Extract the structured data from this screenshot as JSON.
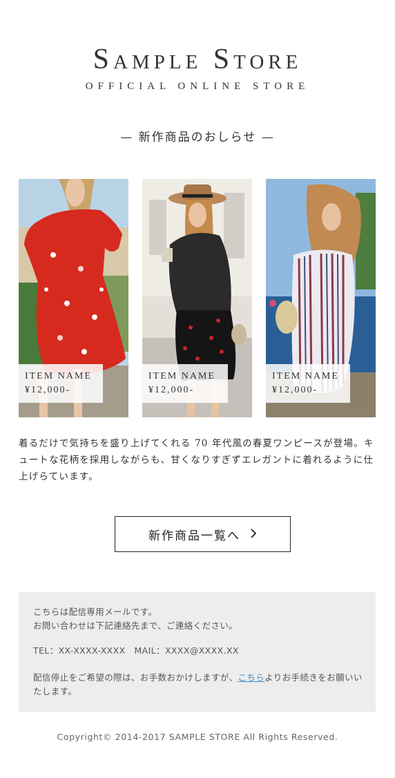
{
  "header": {
    "logo": "Sample Store",
    "tagline": "OFFICIAL ONLINE STORE"
  },
  "section": {
    "title": "— 新作商品のおしらせ —"
  },
  "products": [
    {
      "name": "ITEM NAME",
      "price": "¥12,000-",
      "image": "red-floral-dress-photo"
    },
    {
      "name": "ITEM NAME",
      "price": "¥12,000-",
      "image": "leather-jacket-cherry-skirt-photo"
    },
    {
      "name": "ITEM NAME",
      "price": "¥12,000-",
      "image": "striped-offshoulder-dress-photo"
    }
  ],
  "description": "着るだけで気持ちを盛り上げてくれる 70 年代風の春夏ワンピースが登場。キュートな花柄を採用しながらも、甘くなりすぎずエレガントに着れるように仕上げらています。",
  "cta": {
    "label": "新作商品一覧へ",
    "icon": "chevron-right-icon"
  },
  "info": {
    "notice_line1": "こちらは配信専用メールです。",
    "notice_line2": "お問い合わせは下記連絡先まで、ご連絡ください。",
    "contact": "TEL：XX-XXXX-XXXX　MAIL：XXXX@XXXX.XX",
    "unsubscribe_before": "配信停止をご希望の際は、お手数おかけしますが、",
    "unsubscribe_link": "こちら",
    "unsubscribe_after": "よりお手続きをお願いいたします。"
  },
  "footer": {
    "copyright": "Copyright© 2014-2017 SAMPLE STORE All Rights Reserved."
  },
  "colors": {
    "background": "#ffffff",
    "info_background": "#ededed",
    "link": "#3a8fd1",
    "text": "#333333"
  }
}
